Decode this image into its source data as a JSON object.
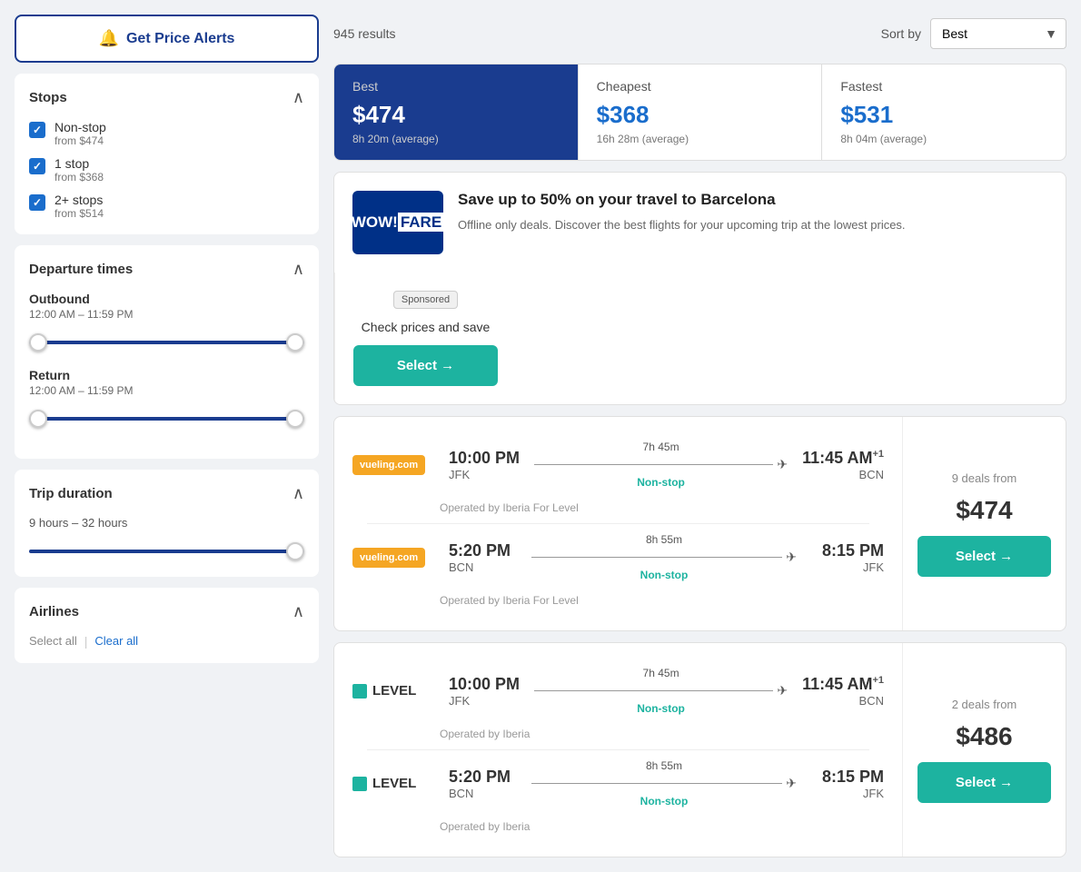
{
  "sidebar": {
    "price_alert_label": "Get Price Alerts",
    "stops_title": "Stops",
    "stops": [
      {
        "label": "Non-stop",
        "sub": "from $474",
        "checked": true
      },
      {
        "label": "1 stop",
        "sub": "from $368",
        "checked": true
      },
      {
        "label": "2+ stops",
        "sub": "from $514",
        "checked": true
      }
    ],
    "departure_title": "Departure times",
    "outbound_label": "Outbound",
    "outbound_range": "12:00 AM – 11:59 PM",
    "return_label": "Return",
    "return_range": "12:00 AM – 11:59 PM",
    "trip_duration_title": "Trip duration",
    "trip_duration_range": "9 hours – 32 hours",
    "airlines_title": "Airlines",
    "select_all": "Select all",
    "clear_all": "Clear all"
  },
  "header": {
    "results_count": "945 results",
    "sort_label": "Sort by",
    "sort_value": "Best",
    "sort_options": [
      "Best",
      "Cheapest",
      "Fastest"
    ]
  },
  "price_tabs": [
    {
      "label": "Best",
      "amount": "$474",
      "duration": "8h 20m (average)",
      "active": true
    },
    {
      "label": "Cheapest",
      "amount": "$368",
      "duration": "16h 28m (average)",
      "active": false
    },
    {
      "label": "Fastest",
      "amount": "$531",
      "duration": "8h 04m (average)",
      "active": false
    }
  ],
  "sponsored": {
    "logo_text": "WOW!FARE",
    "title": "Save up to 50% on your travel to Barcelona",
    "description": "Offline only deals. Discover the best flights for your upcoming trip at the lowest prices.",
    "badge": "Sponsored",
    "cta_text": "Check prices and save",
    "select_label": "Select →"
  },
  "flights": [
    {
      "airline": "vueling",
      "deals_count": "9 deals from",
      "price": "$474",
      "outbound": {
        "depart_time": "10:00 PM",
        "depart_airport": "JFK",
        "duration": "7h 45m",
        "stops": "Non-stop",
        "arrive_time": "11:45 AM",
        "arrive_plus": "+1",
        "arrive_airport": "BCN",
        "operated": "Operated by Iberia For Level"
      },
      "return": {
        "depart_time": "5:20 PM",
        "depart_airport": "BCN",
        "duration": "8h 55m",
        "stops": "Non-stop",
        "arrive_time": "8:15 PM",
        "arrive_plus": "",
        "arrive_airport": "JFK",
        "operated": "Operated by Iberia For Level"
      },
      "select_label": "Select →"
    },
    {
      "airline": "level",
      "deals_count": "2 deals from",
      "price": "$486",
      "outbound": {
        "depart_time": "10:00 PM",
        "depart_airport": "JFK",
        "duration": "7h 45m",
        "stops": "Non-stop",
        "arrive_time": "11:45 AM",
        "arrive_plus": "+1",
        "arrive_airport": "BCN",
        "operated": "Operated by Iberia"
      },
      "return": {
        "depart_time": "5:20 PM",
        "depart_airport": "BCN",
        "duration": "8h 55m",
        "stops": "Non-stop",
        "arrive_time": "8:15 PM",
        "arrive_plus": "",
        "arrive_airport": "JFK",
        "operated": "Operated by Iberia"
      },
      "select_label": "Select →"
    }
  ]
}
